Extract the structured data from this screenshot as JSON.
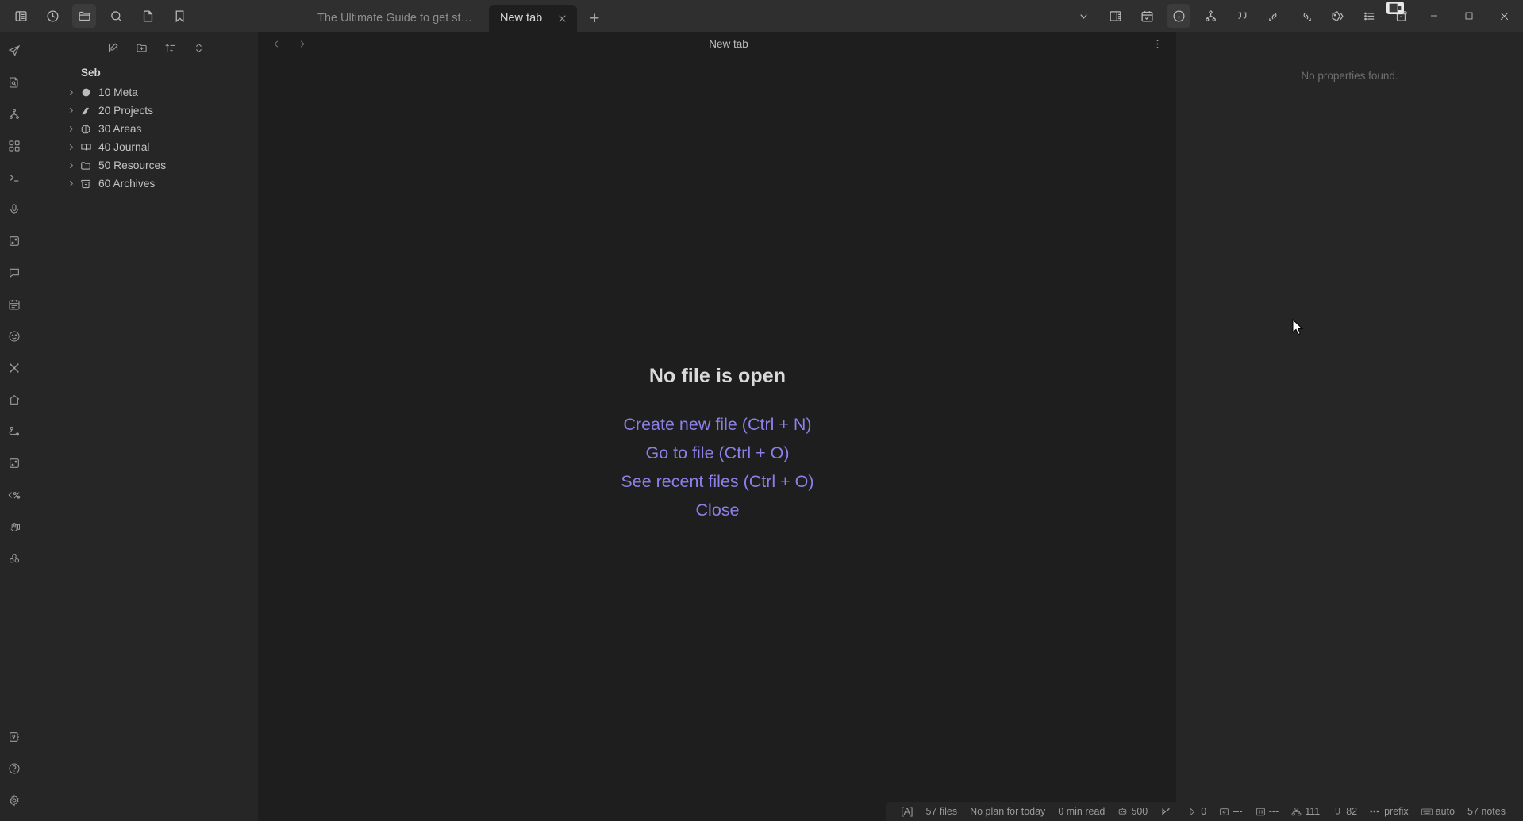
{
  "window": {
    "left_toolbar_icons": [
      {
        "name": "toggle-left-sidebar-icon",
        "active": false
      },
      {
        "name": "recent-files-icon",
        "active": false
      },
      {
        "name": "folder-icon",
        "active": true
      },
      {
        "name": "search-icon",
        "active": false
      },
      {
        "name": "file-icon",
        "active": false
      },
      {
        "name": "bookmark-icon",
        "active": false
      }
    ],
    "right_toolbar_icons": [
      {
        "name": "chevron-down-icon",
        "active": false
      },
      {
        "name": "toggle-right-sidebar-icon",
        "active": false
      },
      {
        "name": "calendar-check-icon",
        "active": false
      },
      {
        "name": "info-circle-icon",
        "active": true
      },
      {
        "name": "graph-fork-icon",
        "active": false
      },
      {
        "name": "quote-icon",
        "active": false
      },
      {
        "name": "link-back-icon",
        "active": false
      },
      {
        "name": "link-forward-icon",
        "active": false
      },
      {
        "name": "tags-icon",
        "active": false
      },
      {
        "name": "outline-list-icon",
        "active": false
      },
      {
        "name": "archive-icon",
        "active": false
      }
    ],
    "window_controls": {
      "minimize": "minimize-icon",
      "maximize": "maximize-icon",
      "close": "close-icon"
    }
  },
  "tabs": {
    "items": [
      {
        "title": "The Ultimate Guide to get star...",
        "active": false
      },
      {
        "title": "New tab",
        "active": true
      }
    ],
    "new_tab_label": "+",
    "close_label": "✕"
  },
  "explorer": {
    "toolbar": [
      {
        "name": "new-note-icon"
      },
      {
        "name": "new-folder-icon"
      },
      {
        "name": "sort-icon"
      },
      {
        "name": "collapse-expand-icon"
      }
    ],
    "vault_name": "Seb",
    "tree": [
      {
        "label": "10 Meta",
        "icon": "circle-icon",
        "expanded": false
      },
      {
        "label": "20 Projects",
        "icon": "ramp-icon",
        "expanded": false
      },
      {
        "label": "30 Areas",
        "icon": "brain-icon",
        "expanded": false
      },
      {
        "label": "40 Journal",
        "icon": "book-open-icon",
        "expanded": false
      },
      {
        "label": "50 Resources",
        "icon": "folder-icon",
        "expanded": false
      },
      {
        "label": "60 Archives",
        "icon": "archive-box-icon",
        "expanded": false
      }
    ]
  },
  "ribbon": {
    "top_items": [
      {
        "name": "paper-plane-icon"
      },
      {
        "name": "file-search-icon"
      },
      {
        "name": "graph-fork-icon"
      },
      {
        "name": "grid-apps-icon"
      },
      {
        "name": "terminal-icon"
      },
      {
        "name": "microphone-icon"
      },
      {
        "name": "dice-icon"
      },
      {
        "name": "comment-icon"
      },
      {
        "name": "calendar-icon"
      },
      {
        "name": "smiley-icon"
      },
      {
        "name": "crossed-tools-icon"
      },
      {
        "name": "home-icon"
      },
      {
        "name": "path-node-icon"
      },
      {
        "name": "dice-icon-2"
      },
      {
        "name": "percent-code-icon"
      },
      {
        "name": "hand-pointer-icon"
      },
      {
        "name": "molecule-icon"
      }
    ],
    "bottom_items": [
      {
        "name": "vault-key-icon"
      },
      {
        "name": "help-circle-icon"
      },
      {
        "name": "settings-gear-icon"
      }
    ]
  },
  "view_header": {
    "back_icon": "arrow-left-icon",
    "forward_icon": "arrow-right-icon",
    "title": "New tab",
    "more_icon": "more-vertical-icon"
  },
  "empty_state": {
    "title": "No file is open",
    "actions": [
      "Create new file (Ctrl + N)",
      "Go to file (Ctrl + O)",
      "See recent files (Ctrl + O)",
      "Close"
    ]
  },
  "properties_pane": {
    "empty_text": "No properties found."
  },
  "status_bar": {
    "items": [
      {
        "icon": null,
        "text": "[A]",
        "name": "status-mode"
      },
      {
        "icon": null,
        "text": "57 files",
        "name": "status-file-count"
      },
      {
        "icon": null,
        "text": "No plan for today",
        "name": "status-daily-plan"
      },
      {
        "icon": null,
        "text": "0 min read",
        "name": "status-read-time"
      },
      {
        "icon": "robot-icon",
        "text": "500",
        "name": "status-ai-tokens"
      },
      {
        "icon": "no-sync-icon",
        "text": "",
        "name": "status-sync-off"
      },
      {
        "icon": "contrast-icon",
        "text": "0",
        "name": "status-contrast"
      },
      {
        "icon": "image-icon",
        "text": "---",
        "name": "status-image"
      },
      {
        "icon": "chart-icon",
        "text": "---",
        "name": "status-chart"
      },
      {
        "icon": "network-icon",
        "text": "111",
        "name": "status-links"
      },
      {
        "icon": "magnet-icon",
        "text": "82",
        "name": "status-attachments"
      },
      {
        "icon": "prefix-icon",
        "text": "prefix",
        "name": "status-prefix"
      },
      {
        "icon": "keyboard-icon",
        "text": "auto",
        "name": "status-keyboard"
      },
      {
        "icon": null,
        "text": "57 notes",
        "name": "status-note-count"
      }
    ]
  },
  "colors": {
    "accent": "#8b7fe8",
    "titlebar_bg": "#2f2f2f",
    "sidebar_bg": "#262626",
    "editor_bg": "#1e1e1e"
  }
}
